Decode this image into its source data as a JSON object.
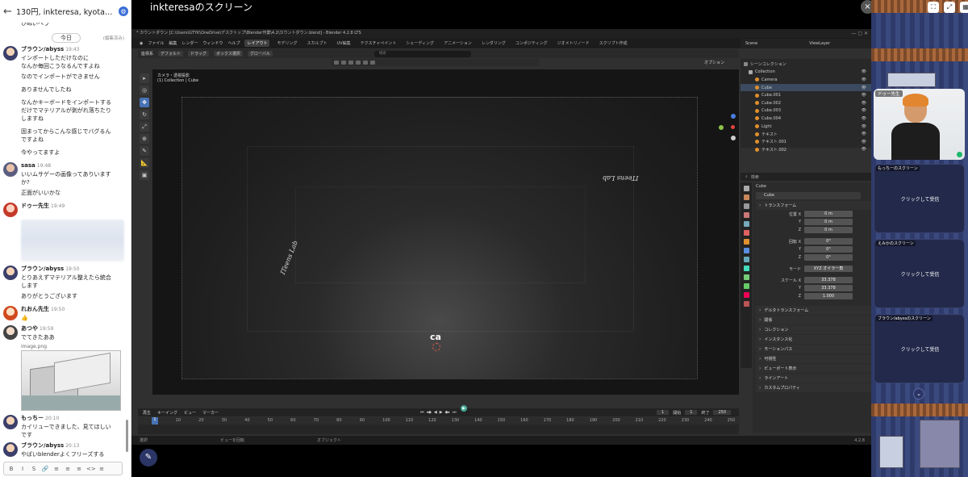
{
  "chat": {
    "title": "130円, inkteresa, kyotaro…",
    "day_label": "今日",
    "edited_label": "(編集済み)",
    "messages": [
      {
        "author": "",
        "time": "",
        "lines": [
          "ひぬいへう",
          ""
        ]
      },
      {
        "author": "ブラウン/abyss",
        "time": "19:43",
        "lines": [
          "インポートしただけなのに",
          "なんか毎回こうなるんですよね"
        ]
      },
      {
        "author": "",
        "time": "",
        "lines": [
          "なのでインポートができません"
        ]
      },
      {
        "author": "",
        "time": "",
        "lines": [
          "ありませんでしたね"
        ]
      },
      {
        "author": "",
        "time": "",
        "lines": [
          "なんかキーボードをインポートする",
          "だけでマテリアルが剥がれ落ちたり",
          "しますね"
        ]
      },
      {
        "author": "",
        "time": "",
        "lines": [
          "固まってからこんな感じでバグるん",
          "ですよね"
        ]
      },
      {
        "author": "",
        "time": "",
        "lines": [
          "今やってますよ"
        ]
      },
      {
        "author": "sasa",
        "time": "19:48",
        "lines": [
          "いいムサゲーの画像ってありいます",
          "か?"
        ]
      },
      {
        "author": "",
        "time": "",
        "lines": [
          "正面がいいかな"
        ]
      },
      {
        "author": "ドゥー先生",
        "time": "19:49",
        "lines": []
      },
      {
        "author": "ブラウン/abyss",
        "time": "19:50",
        "lines": [
          "とりあえずマテリアル整えたら統合",
          "します"
        ]
      },
      {
        "author": "",
        "time": "",
        "lines": [
          "ありがとうございます"
        ]
      },
      {
        "author": "れおん先生",
        "time": "19:50",
        "lines": [
          "👍"
        ]
      },
      {
        "author": "あつや",
        "time": "19:59",
        "lines": [
          "でてきたああ"
        ]
      },
      {
        "author": "",
        "time": "",
        "lines": [
          "image.png"
        ]
      },
      {
        "author": "もっちー",
        "time": "20:10",
        "lines": [
          "カイリューできました、見てほしい",
          "です"
        ]
      },
      {
        "author": "ブラウン/abyss",
        "time": "20:13",
        "lines": [
          "やばいblenderよくフリーズする"
        ]
      }
    ],
    "toolbar_items": [
      "B",
      "I",
      "S",
      "🔗",
      "≡",
      "≡",
      "≡",
      "<>",
      "≡"
    ]
  },
  "share": {
    "title": "inkteresaのスクリーン",
    "close": "×"
  },
  "blender": {
    "window_title": "* カウントダウン [C:\\Users\\GTYK\\OneDrive\\デスクトップ\\Blender作業\\4.2\\カウントダウン.blend] - Blender 4.2.8 LTS",
    "menu": [
      "ファイル",
      "編集",
      "レンダー",
      "ウィンドウ",
      "ヘルプ"
    ],
    "workspaces": [
      "レイアウト",
      "モデリング",
      "スカルプト",
      "UV編集",
      "テクスチャペイント",
      "シェーディング",
      "アニメーション",
      "レンダリング",
      "コンポジティング",
      "ジオメトリノード",
      "スクリプト作成"
    ],
    "scene": "Scene",
    "view_layer": "ViewLayer",
    "vp_header": [
      "座標系",
      "デフォルト",
      "ドラッグ",
      "ボックス選択"
    ],
    "mode": "オブジェクトモード",
    "view_menu": [
      "ビュー",
      "選択",
      "追加",
      "オブジェクト"
    ],
    "transform": "グローバル",
    "search_placeholder": "検索",
    "options": "オプション",
    "viewport_info1": "カメラ・透視投影",
    "viewport_info2": "(1) Collection | Cube",
    "text_obj1": "ITeens Lab",
    "text_obj2": "ITeens Lab",
    "ca_text": "ca",
    "outliner_header": "シーンコレクション",
    "outliner": [
      {
        "name": "Collection",
        "color": "#aaaaaa"
      },
      {
        "name": "Camera",
        "color": "#e0902e"
      },
      {
        "name": "Cube",
        "color": "#e0902e"
      },
      {
        "name": "Cube.001",
        "color": "#e0902e"
      },
      {
        "name": "Cube.002",
        "color": "#e0902e"
      },
      {
        "name": "Cube.003",
        "color": "#e0902e"
      },
      {
        "name": "Cube.004",
        "color": "#e0902e"
      },
      {
        "name": "Light",
        "color": "#e0902e"
      },
      {
        "name": "テキスト",
        "color": "#e0902e"
      },
      {
        "name": "テキスト.001",
        "color": "#e0902e"
      },
      {
        "name": "テキスト.002",
        "color": "#e0902e"
      }
    ],
    "props_search": "検索",
    "object_name": "Cube",
    "object_data": "Cube",
    "transform_section": "トランスフォーム",
    "location_label": "位置 X",
    "location": [
      "0 m",
      "0 m",
      "0 m"
    ],
    "rotation_label": "回転 X",
    "rotation": [
      "0°",
      "0°",
      "0°"
    ],
    "rot_mode_label": "モード",
    "rot_mode": "XYZ オイラー角",
    "scale_label": "スケール X",
    "scale": [
      "33.378",
      "33.378",
      "1.000"
    ],
    "delta": "デルタトランスフォーム",
    "sections": [
      "関係",
      "コレクション",
      "インスタンス化",
      "モーションパス",
      "可視性",
      "ビューポート表示",
      "ラインアート",
      "カスタムプロパティ"
    ],
    "timeline_menu": [
      "再生",
      "キーイング",
      "ビュー",
      "マーカー"
    ],
    "current_frame": "1",
    "start_label": "開始",
    "start": "1",
    "end_label": "終了",
    "end": "250",
    "ruler": [
      "1",
      "10",
      "20",
      "30",
      "40",
      "50",
      "60",
      "70",
      "80",
      "90",
      "100",
      "110",
      "120",
      "130",
      "140",
      "150",
      "160",
      "170",
      "180",
      "190",
      "200",
      "210",
      "220",
      "230",
      "240",
      "250"
    ],
    "status": [
      "選択",
      "ビューを回転",
      "オブジェクト"
    ],
    "version": "4.2.8"
  },
  "side": {
    "cam_label": "ドゥー先生",
    "tiles": [
      {
        "label": "もっちーのスクリーン",
        "cta": "クリックして受信"
      },
      {
        "label": "えみかのスクリーン",
        "cta": "クリックして受信"
      },
      {
        "label": "ブラウン/abyssのスクリーン",
        "cta": "クリックして受信"
      }
    ],
    "more": "⌄"
  }
}
